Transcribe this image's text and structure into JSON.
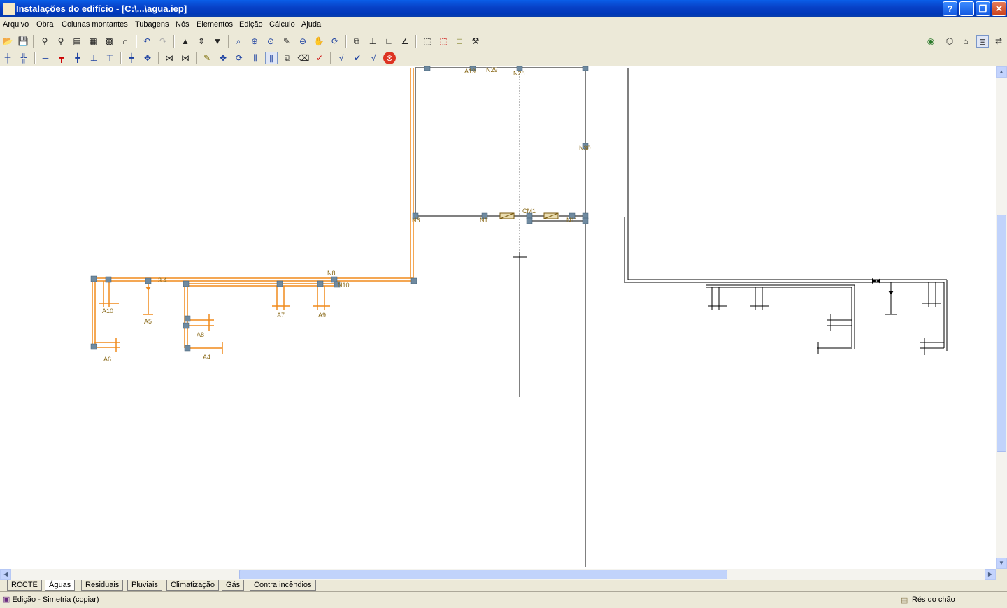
{
  "window": {
    "title": "Instalações do edifício - [C:\\...\\agua.iep]"
  },
  "title_buttons": {
    "help": "?",
    "minimize": "_",
    "restore": "❐",
    "close": "✕"
  },
  "menu": [
    "Arquivo",
    "Obra",
    "Colunas montantes",
    "Tubagens",
    "Nós",
    "Elementos",
    "Edição",
    "Cálculo",
    "Ajuda"
  ],
  "toolbar1": [
    {
      "icon": "open-folder-icon",
      "glyph": "📂"
    },
    {
      "icon": "save-icon",
      "glyph": "💾"
    },
    {
      "icon": "fixture-icon",
      "glyph": "⚲"
    },
    {
      "icon": "fixture-gray-icon",
      "glyph": "⚲"
    },
    {
      "icon": "text-icon",
      "glyph": "▤"
    },
    {
      "icon": "table-icon",
      "glyph": "▦"
    },
    {
      "icon": "grid-icon",
      "glyph": "▩"
    },
    {
      "icon": "magnet-icon",
      "glyph": "∩"
    },
    {
      "icon": "undo-icon",
      "glyph": "↶"
    },
    {
      "icon": "redo-icon",
      "glyph": "↷"
    },
    {
      "icon": "arrow-up-icon",
      "glyph": "▲"
    },
    {
      "icon": "arrow-updown-icon",
      "glyph": "⇕"
    },
    {
      "icon": "arrow-down-icon",
      "glyph": "▼"
    },
    {
      "icon": "zoom-window-icon",
      "glyph": "⌕"
    },
    {
      "icon": "zoom-in-icon",
      "glyph": "⊕"
    },
    {
      "icon": "zoom-icon",
      "glyph": "⊙"
    },
    {
      "icon": "pencil-icon",
      "glyph": "✎"
    },
    {
      "icon": "zoom-out-icon",
      "glyph": "⊖"
    },
    {
      "icon": "pan-hand-icon",
      "glyph": "✋"
    },
    {
      "icon": "redraw-icon",
      "glyph": "⟳"
    },
    {
      "icon": "binoculars-icon",
      "glyph": "⧉"
    },
    {
      "icon": "axis-icon",
      "glyph": "⊥"
    },
    {
      "icon": "angle-icon",
      "glyph": "∟"
    },
    {
      "icon": "slope-icon",
      "glyph": "∠"
    },
    {
      "icon": "select-icon",
      "glyph": "⬚"
    },
    {
      "icon": "select-red-icon",
      "glyph": "⬚"
    },
    {
      "icon": "rectangle-icon",
      "glyph": "□"
    },
    {
      "icon": "tools-icon",
      "glyph": "⚒"
    }
  ],
  "toolbar1_right": [
    {
      "icon": "globe-icon",
      "glyph": "◉"
    },
    {
      "icon": "3d-box-icon",
      "glyph": "⬡"
    },
    {
      "icon": "3d-house-icon",
      "glyph": "⌂"
    },
    {
      "icon": "tile-icon",
      "glyph": "⊟"
    },
    {
      "icon": "swap-icon",
      "glyph": "⇄"
    }
  ],
  "toolbar2": [
    {
      "icon": "pipe-add-icon",
      "glyph": "╪"
    },
    {
      "icon": "pipe-branch-icon",
      "glyph": "╬"
    },
    {
      "icon": "line-icon",
      "glyph": "─"
    },
    {
      "icon": "tee-icon",
      "glyph": "┳"
    },
    {
      "icon": "cross-icon",
      "glyph": "╋"
    },
    {
      "icon": "valve-up-icon",
      "glyph": "⊥"
    },
    {
      "icon": "valve-down-icon",
      "glyph": "⊤"
    },
    {
      "icon": "node-icon",
      "glyph": "┿"
    },
    {
      "icon": "node-move-icon",
      "glyph": "✥"
    },
    {
      "icon": "mirror-icon",
      "glyph": "⋈"
    },
    {
      "icon": "mirror-copy-icon",
      "glyph": "⋈"
    },
    {
      "icon": "edit-pencil-icon",
      "glyph": "✎"
    },
    {
      "icon": "move-icon",
      "glyph": "✥"
    },
    {
      "icon": "rotate-icon",
      "glyph": "⟳"
    },
    {
      "icon": "symmetry-icon",
      "glyph": "⫼"
    },
    {
      "icon": "symmetry-copy-icon",
      "glyph": "⫼",
      "pressed": true
    },
    {
      "icon": "copy-icon",
      "glyph": "⧉"
    },
    {
      "icon": "erase-icon",
      "glyph": "⌫"
    },
    {
      "icon": "edit-check-icon",
      "glyph": "✓"
    },
    {
      "icon": "calc-check-icon",
      "glyph": "√"
    },
    {
      "icon": "check-icon",
      "glyph": "✔"
    },
    {
      "icon": "verify-icon",
      "glyph": "√"
    },
    {
      "icon": "stop-icon",
      "glyph": "⊗"
    }
  ],
  "labels": {
    "A19": "A19",
    "N29": "N29",
    "N28": "N28",
    "N30": "N30",
    "N6": "N6",
    "N1": "N1",
    "CM1": "CM1",
    "N11": "N11",
    "N8": "N8",
    "N10": "N10",
    "A10": "A10",
    "A5": "A5",
    "A7": "A7",
    "A9": "A9",
    "A8": "A8",
    "A4": "A4",
    "A6": "A6",
    "n34": "3.4"
  },
  "colors": {
    "pipe_orange": "#f08a1c",
    "node_gray": "#6f8aa0",
    "pipe_black": "#000000"
  },
  "tabs": [
    "RCCTE",
    "Águas",
    "Residuais",
    "Pluviais",
    "Climatização",
    "Gás",
    "Contra incêndios"
  ],
  "active_tab": "Águas",
  "status": {
    "mode": "Edição - Simetria (copiar)",
    "floor": "Rés do chão"
  }
}
